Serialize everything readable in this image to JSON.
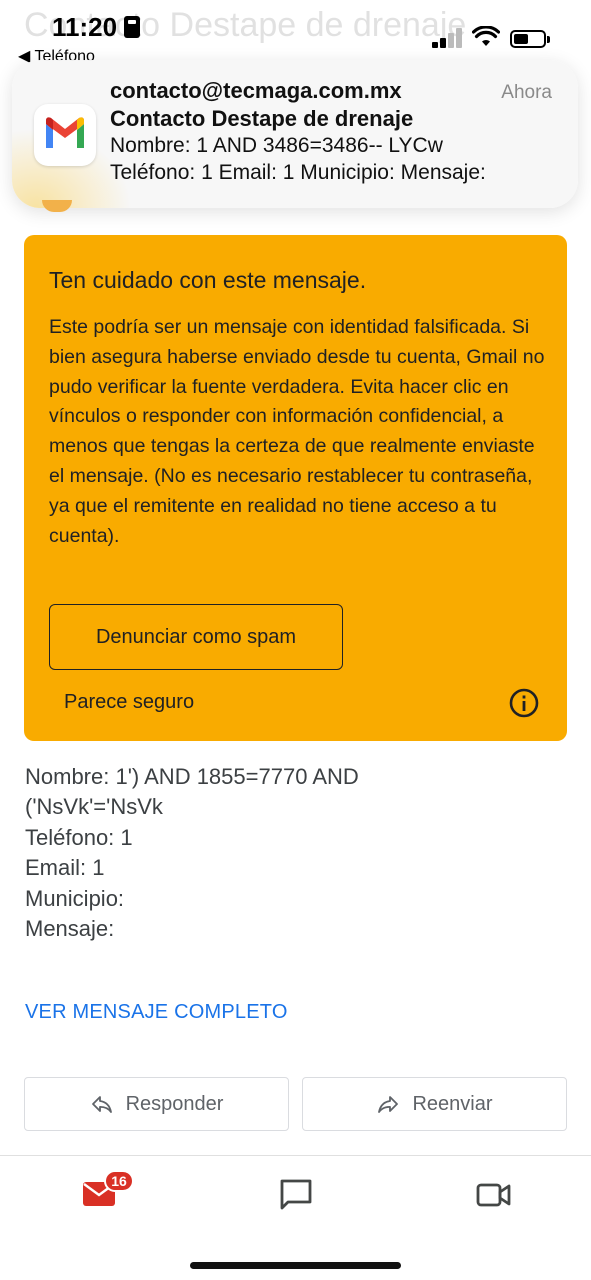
{
  "status_bar": {
    "time": "11:20",
    "back_label": "◀ Teléfono",
    "background_subject": "Contacto Destape de drenaje"
  },
  "notification": {
    "from": "contacto@tecmaga.com.mx",
    "time": "Ahora",
    "subject": "Contacto Destape de drenaje",
    "line1": "Nombre: 1 AND 3486=3486-- LYCw",
    "line2": "Teléfono: 1 Email: 1 Municipio: Mensaje:",
    "app_icon": "gmail-logo-icon"
  },
  "warning": {
    "title": "Ten cuidado con este mensaje.",
    "body": "Este podría ser un mensaje con identidad falsificada. Si bien asegura haberse enviado desde tu cuenta, Gmail no pudo verificar la fuente verdadera. Evita hacer clic en vínculos o responder con información confidencial, a menos que tengas la certeza de que realmente enviaste el mensaje. (No es necesario restablecer tu contraseña, ya que el remitente en realidad no tiene acceso a tu cuenta).",
    "spam_button": "Denunciar como spam",
    "safe_link": "Parece seguro",
    "bg_color": "#f9ab00"
  },
  "message": {
    "lines": [
      "Nombre: 1') AND 1855=7770 AND",
      "('NsVk'='NsVk",
      "Teléfono: 1",
      "Email: 1",
      "Municipio:",
      "Mensaje:"
    ],
    "view_full": "VER MENSAJE COMPLETO"
  },
  "actions": {
    "reply": "Responder",
    "forward": "Reenviar"
  },
  "bottom_nav": {
    "mail_badge": "16",
    "badge_color": "#d93025",
    "items": [
      "mail-icon",
      "chat-icon",
      "meet-video-icon"
    ]
  }
}
